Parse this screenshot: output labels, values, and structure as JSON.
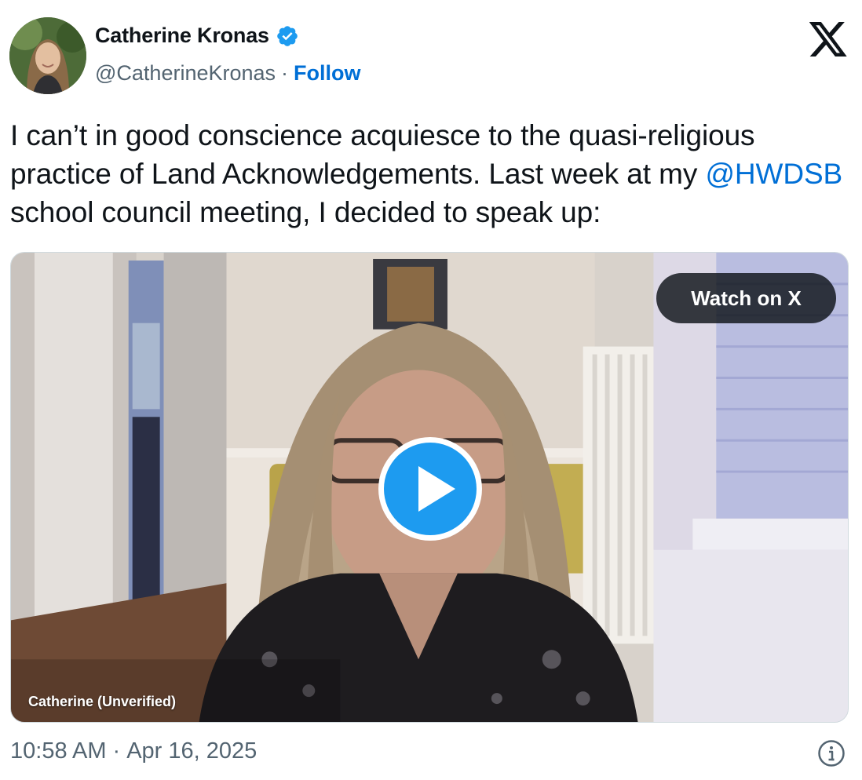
{
  "author": {
    "name": "Catherine Kronas",
    "handle": "@CatherineKronas",
    "separator": "·",
    "follow_label": "Follow",
    "verified_icon": "verified-badge-icon"
  },
  "brand": {
    "logo_icon": "x-logo-icon"
  },
  "tweet": {
    "text_part1": "I can’t in good conscience acquiesce to the quasi-religious practice of Land Acknowledgements. Last week at my ",
    "mention": "@HWDSB",
    "text_part2": " school council meeting, I decided to speak up:"
  },
  "media": {
    "watch_label": "Watch on X",
    "caption": "Catherine (Unverified)",
    "play_icon": "play-icon"
  },
  "footer": {
    "time": "10:58 AM",
    "separator": "·",
    "date": "Apr 16, 2025",
    "info_icon": "info-icon"
  },
  "colors": {
    "link": "#006fd6",
    "text": "#0f1419",
    "secondary": "#536471",
    "play_blue": "#1d9bf0"
  }
}
